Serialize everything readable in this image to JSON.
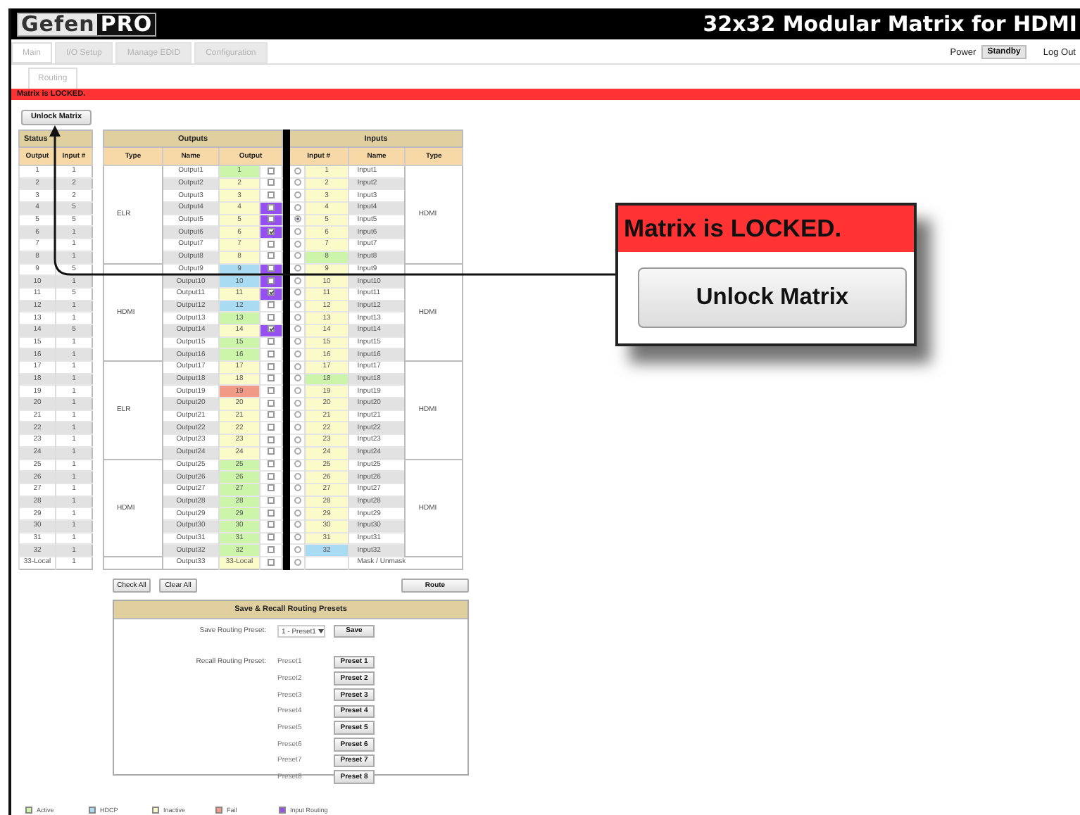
{
  "header": {
    "logo_left": "Gefen",
    "logo_right": "PRO",
    "title": "32x32 Modular Matrix for HDMI"
  },
  "tabs": [
    {
      "label": "Main",
      "selected": true
    },
    {
      "label": "I/O Setup",
      "selected": false
    },
    {
      "label": "Manage EDID",
      "selected": false
    },
    {
      "label": "Configuration",
      "selected": false
    }
  ],
  "power": {
    "label": "Power",
    "button": "Standby"
  },
  "logout": "Log Out",
  "subtabs": [
    {
      "label": "Routing",
      "selected": true
    }
  ],
  "banner": "Matrix is LOCKED.",
  "unlock_button": "Unlock Matrix",
  "status_table": {
    "title": "Status",
    "columns": [
      "Output",
      "Input #"
    ],
    "rows": [
      [
        "1",
        "1"
      ],
      [
        "2",
        "2"
      ],
      [
        "3",
        "2"
      ],
      [
        "4",
        "5"
      ],
      [
        "5",
        "5"
      ],
      [
        "6",
        "1"
      ],
      [
        "7",
        "1"
      ],
      [
        "8",
        "1"
      ],
      [
        "9",
        "5"
      ],
      [
        "10",
        "1"
      ],
      [
        "11",
        "5"
      ],
      [
        "12",
        "1"
      ],
      [
        "13",
        "1"
      ],
      [
        "14",
        "5"
      ],
      [
        "15",
        "1"
      ],
      [
        "16",
        "1"
      ],
      [
        "17",
        "1"
      ],
      [
        "18",
        "1"
      ],
      [
        "19",
        "1"
      ],
      [
        "20",
        "1"
      ],
      [
        "21",
        "1"
      ],
      [
        "22",
        "1"
      ],
      [
        "23",
        "1"
      ],
      [
        "24",
        "1"
      ],
      [
        "25",
        "1"
      ],
      [
        "26",
        "1"
      ],
      [
        "27",
        "1"
      ],
      [
        "28",
        "1"
      ],
      [
        "29",
        "1"
      ],
      [
        "30",
        "1"
      ],
      [
        "31",
        "1"
      ],
      [
        "32",
        "1"
      ],
      [
        "33-Local",
        "1"
      ]
    ]
  },
  "outputs": {
    "title": "Outputs",
    "columns": [
      "Type",
      "Name",
      "Output"
    ],
    "groups": [
      {
        "type": "ELR",
        "rows": [
          {
            "name": "Output1",
            "number": "1",
            "color": "#cdf5aa",
            "routing": false,
            "checked": false
          },
          {
            "name": "Output2",
            "number": "2",
            "color": "#fafbc9",
            "routing": false,
            "checked": false
          },
          {
            "name": "Output3",
            "number": "3",
            "color": "#fafbc9",
            "routing": false,
            "checked": false
          },
          {
            "name": "Output4",
            "number": "4",
            "color": "#fafbc9",
            "routing": true,
            "checked": false
          },
          {
            "name": "Output5",
            "number": "5",
            "color": "#fafbc9",
            "routing": true,
            "checked": false
          },
          {
            "name": "Output6",
            "number": "6",
            "color": "#fafbc9",
            "routing": true,
            "checked": true
          },
          {
            "name": "Output7",
            "number": "7",
            "color": "#fafbc9",
            "routing": false,
            "checked": false
          },
          {
            "name": "Output8",
            "number": "8",
            "color": "#fafbc9",
            "routing": false,
            "checked": false
          }
        ]
      },
      {
        "type": "HDMI",
        "rows": [
          {
            "name": "Output9",
            "number": "9",
            "color": "#a9dcf2",
            "routing": true,
            "checked": false
          },
          {
            "name": "Output10",
            "number": "10",
            "color": "#a9dcf2",
            "routing": true,
            "checked": false
          },
          {
            "name": "Output11",
            "number": "11",
            "color": "#fafbc9",
            "routing": true,
            "checked": true
          },
          {
            "name": "Output12",
            "number": "12",
            "color": "#a9dcf2",
            "routing": false,
            "checked": false
          },
          {
            "name": "Output13",
            "number": "13",
            "color": "#cdf5aa",
            "routing": false,
            "checked": false
          },
          {
            "name": "Output14",
            "number": "14",
            "color": "#fafbc9",
            "routing": true,
            "checked": true
          },
          {
            "name": "Output15",
            "number": "15",
            "color": "#cdf5aa",
            "routing": false,
            "checked": false
          },
          {
            "name": "Output16",
            "number": "16",
            "color": "#cdf5aa",
            "routing": false,
            "checked": false
          }
        ]
      },
      {
        "type": "ELR",
        "rows": [
          {
            "name": "Output17",
            "number": "17",
            "color": "#fafbc9",
            "routing": false,
            "checked": false
          },
          {
            "name": "Output18",
            "number": "18",
            "color": "#fafbc9",
            "routing": false,
            "checked": false
          },
          {
            "name": "Output19",
            "number": "19",
            "color": "#f29a88",
            "routing": false,
            "checked": false
          },
          {
            "name": "Output20",
            "number": "20",
            "color": "#fafbc9",
            "routing": false,
            "checked": false
          },
          {
            "name": "Output21",
            "number": "21",
            "color": "#fafbc9",
            "routing": false,
            "checked": false
          },
          {
            "name": "Output22",
            "number": "22",
            "color": "#fafbc9",
            "routing": false,
            "checked": false
          },
          {
            "name": "Output23",
            "number": "23",
            "color": "#fafbc9",
            "routing": false,
            "checked": false
          },
          {
            "name": "Output24",
            "number": "24",
            "color": "#fafbc9",
            "routing": false,
            "checked": false
          }
        ]
      },
      {
        "type": "HDMI",
        "rows": [
          {
            "name": "Output25",
            "number": "25",
            "color": "#cdf5aa",
            "routing": false,
            "checked": false
          },
          {
            "name": "Output26",
            "number": "26",
            "color": "#cdf5aa",
            "routing": false,
            "checked": false
          },
          {
            "name": "Output27",
            "number": "27",
            "color": "#cdf5aa",
            "routing": false,
            "checked": false
          },
          {
            "name": "Output28",
            "number": "28",
            "color": "#cdf5aa",
            "routing": false,
            "checked": false
          },
          {
            "name": "Output29",
            "number": "29",
            "color": "#cdf5aa",
            "routing": false,
            "checked": false
          },
          {
            "name": "Output30",
            "number": "30",
            "color": "#cdf5aa",
            "routing": false,
            "checked": false
          },
          {
            "name": "Output31",
            "number": "31",
            "color": "#cdf5aa",
            "routing": false,
            "checked": false
          },
          {
            "name": "Output32",
            "number": "32",
            "color": "#cdf5aa",
            "routing": false,
            "checked": false
          }
        ]
      },
      {
        "rows": [
          {
            "name": "Output33",
            "number": "33-Local",
            "color": "#fafbc9",
            "routing": false,
            "checked": false
          }
        ]
      }
    ]
  },
  "inputs": {
    "title": "Inputs",
    "columns": [
      "Input #",
      "Name",
      "Type"
    ],
    "groups": [
      {
        "type": "HDMI",
        "rows": [
          {
            "number": "1",
            "name": "Input1",
            "color": "#fafbc9",
            "selected": false
          },
          {
            "number": "2",
            "name": "Input2",
            "color": "#fafbc9",
            "selected": false
          },
          {
            "number": "3",
            "name": "Input3",
            "color": "#fafbc9",
            "selected": false
          },
          {
            "number": "4",
            "name": "Input4",
            "color": "#fafbc9",
            "selected": false
          },
          {
            "number": "5",
            "name": "Input5",
            "color": "#fafbc9",
            "selected": true
          },
          {
            "number": "6",
            "name": "Input6",
            "color": "#fafbc9",
            "selected": false
          },
          {
            "number": "7",
            "name": "Input7",
            "color": "#fafbc9",
            "selected": false
          },
          {
            "number": "8",
            "name": "Input8",
            "color": "#cdf5aa",
            "selected": false
          }
        ]
      },
      {
        "type": "HDMI",
        "rows": [
          {
            "number": "9",
            "name": "Input9",
            "color": "#fafbc9",
            "selected": false
          },
          {
            "number": "10",
            "name": "Input10",
            "color": "#fafbc9",
            "selected": false
          },
          {
            "number": "11",
            "name": "Input11",
            "color": "#fafbc9",
            "selected": false
          },
          {
            "number": "12",
            "name": "Input12",
            "color": "#fafbc9",
            "selected": false
          },
          {
            "number": "13",
            "name": "Input13",
            "color": "#fafbc9",
            "selected": false
          },
          {
            "number": "14",
            "name": "Input14",
            "color": "#fafbc9",
            "selected": false
          },
          {
            "number": "15",
            "name": "Input15",
            "color": "#fafbc9",
            "selected": false
          },
          {
            "number": "16",
            "name": "Input16",
            "color": "#fafbc9",
            "selected": false
          }
        ]
      },
      {
        "type": "HDMI",
        "rows": [
          {
            "number": "17",
            "name": "Input17",
            "color": "#fafbc9",
            "selected": false
          },
          {
            "number": "18",
            "name": "Input18",
            "color": "#cdf5aa",
            "selected": false
          },
          {
            "number": "19",
            "name": "Input19",
            "color": "#fafbc9",
            "selected": false
          },
          {
            "number": "20",
            "name": "Input20",
            "color": "#fafbc9",
            "selected": false
          },
          {
            "number": "21",
            "name": "Input21",
            "color": "#fafbc9",
            "selected": false
          },
          {
            "number": "22",
            "name": "Input22",
            "color": "#fafbc9",
            "selected": false
          },
          {
            "number": "23",
            "name": "Input23",
            "color": "#fafbc9",
            "selected": false
          },
          {
            "number": "24",
            "name": "Input24",
            "color": "#fafbc9",
            "selected": false
          }
        ]
      },
      {
        "type": "HDMI",
        "rows": [
          {
            "number": "25",
            "name": "Input25",
            "color": "#fafbc9",
            "selected": false
          },
          {
            "number": "26",
            "name": "Input26",
            "color": "#fafbc9",
            "selected": false
          },
          {
            "number": "27",
            "name": "Input27",
            "color": "#fafbc9",
            "selected": false
          },
          {
            "number": "28",
            "name": "Input28",
            "color": "#fafbc9",
            "selected": false
          },
          {
            "number": "29",
            "name": "Input29",
            "color": "#fafbc9",
            "selected": false
          },
          {
            "number": "30",
            "name": "Input30",
            "color": "#fafbc9",
            "selected": false
          },
          {
            "number": "31",
            "name": "Input31",
            "color": "#fafbc9",
            "selected": false
          },
          {
            "number": "32",
            "name": "Input32",
            "color": "#a9dcf2",
            "selected": false
          }
        ]
      }
    ],
    "mask": {
      "label": "Mask / Unmask",
      "selected": false
    }
  },
  "buttons": {
    "check_all": "Check All",
    "clear_all": "Clear All",
    "route": "Route"
  },
  "presets": {
    "title": "Save & Recall Routing Presets",
    "save_label": "Save Routing Preset:",
    "save_select": "1 - Preset1",
    "save_button": "Save",
    "recall_label": "Recall Routing Preset:",
    "items": [
      {
        "name": "Preset1",
        "button": "Preset 1"
      },
      {
        "name": "Preset2",
        "button": "Preset 2"
      },
      {
        "name": "Preset3",
        "button": "Preset 3"
      },
      {
        "name": "Preset4",
        "button": "Preset 4"
      },
      {
        "name": "Preset5",
        "button": "Preset 5"
      },
      {
        "name": "Preset6",
        "button": "Preset 6"
      },
      {
        "name": "Preset7",
        "button": "Preset 7"
      },
      {
        "name": "Preset8",
        "button": "Preset 8"
      }
    ]
  },
  "legend": [
    {
      "label": "Active",
      "color": "#cdf5aa"
    },
    {
      "label": "HDCP",
      "color": "#a9dcf2"
    },
    {
      "label": "Inactive",
      "color": "#fafbc9"
    },
    {
      "label": "Fail",
      "color": "#f29a88"
    },
    {
      "label": "Input Routing",
      "color": "#9650f0"
    }
  ],
  "callout": {
    "banner": "Matrix is LOCKED.",
    "button": "Unlock Matrix"
  }
}
